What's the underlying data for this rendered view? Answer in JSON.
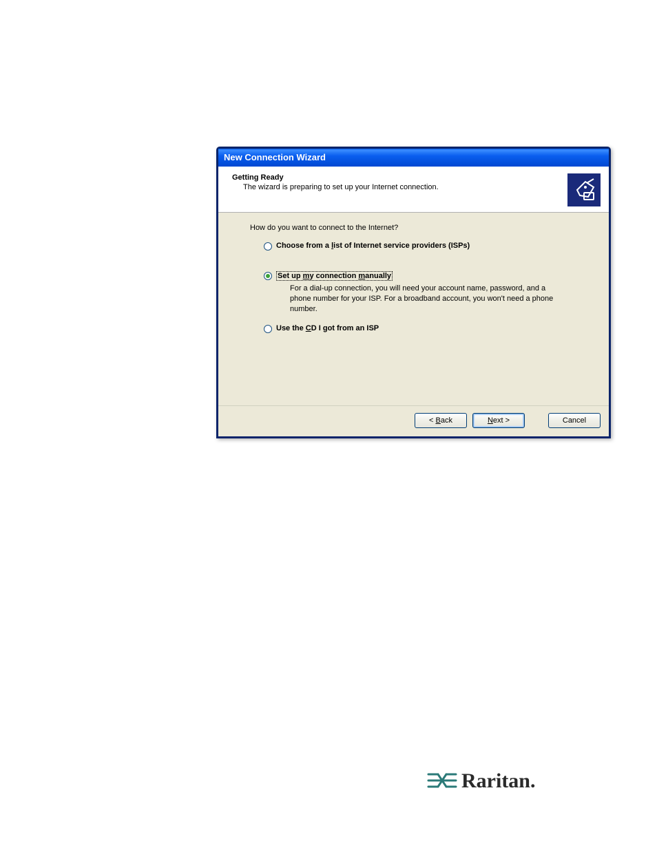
{
  "dialog": {
    "title": "New Connection Wizard",
    "header": {
      "title": "Getting Ready",
      "subtitle": "The wizard is preparing to set up your Internet connection."
    },
    "content": {
      "question": "How do you want to connect to the Internet?",
      "options": [
        {
          "label_pre": "Choose from a ",
          "label_key": "l",
          "label_post": "ist of Internet service providers (ISPs)",
          "checked": false,
          "focused": false,
          "description": ""
        },
        {
          "label_pre": "Set up ",
          "label_key": "m",
          "label_post": "y connection ",
          "label_key2": "m",
          "label_post2": "anually",
          "checked": true,
          "focused": true,
          "description": "For a dial-up connection, you will need your account name, password, and a phone number for your ISP. For a broadband account, you won't need a phone number."
        },
        {
          "label_pre": "Use the ",
          "label_key": "C",
          "label_post": "D I got from an ISP",
          "checked": false,
          "focused": false,
          "description": ""
        }
      ]
    },
    "buttons": {
      "back_pre": "< ",
      "back_key": "B",
      "back_post": "ack",
      "next_key": "N",
      "next_post": "ext >",
      "cancel": "Cancel"
    }
  },
  "brand": {
    "name": "Raritan."
  }
}
